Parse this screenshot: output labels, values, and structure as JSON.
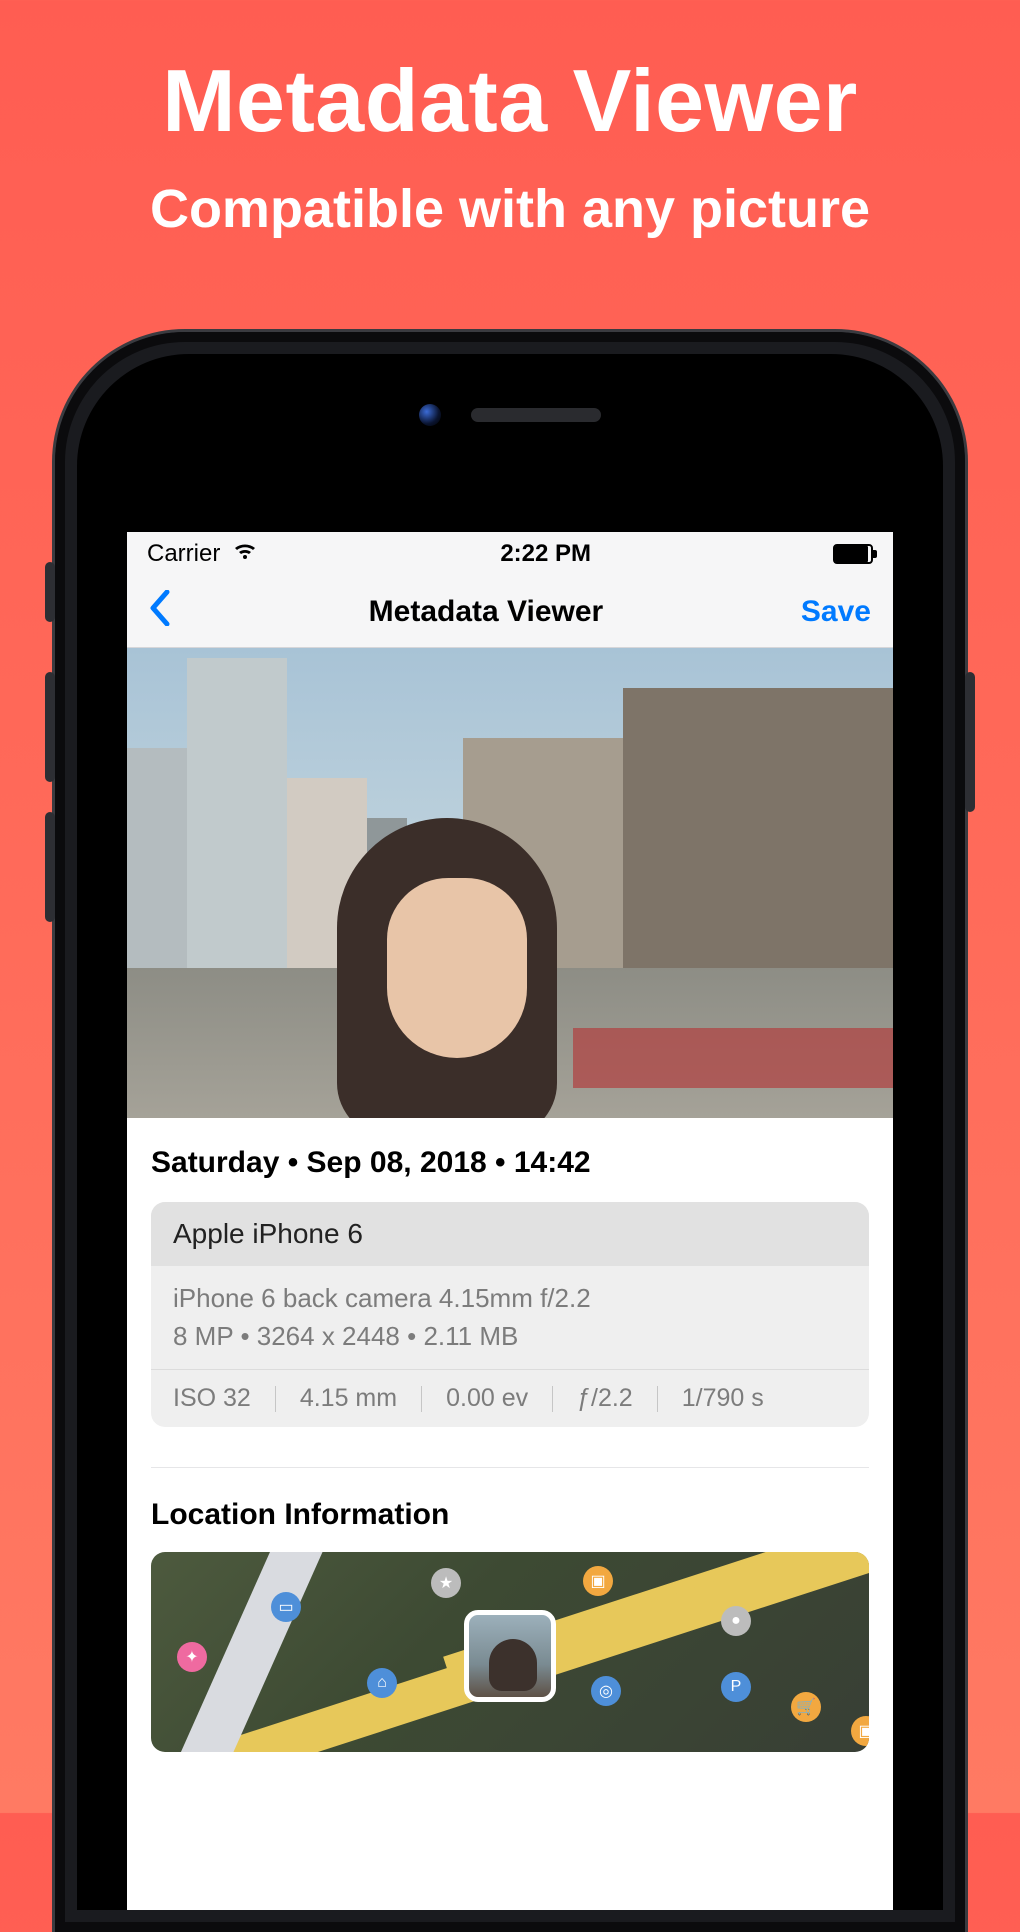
{
  "promo": {
    "title": "Metadata Viewer",
    "subtitle": "Compatible with any picture"
  },
  "statusbar": {
    "carrier": "Carrier",
    "time": "2:22 PM"
  },
  "nav": {
    "title": "Metadata Viewer",
    "save": "Save"
  },
  "datetime": "Saturday • Sep 08, 2018 • 14:42",
  "device_card": {
    "device": "Apple iPhone 6",
    "lens_line": "iPhone 6 back camera 4.15mm f/2.2",
    "resolution_line": "8 MP • 3264 x 2448 • 2.11 MB",
    "exif": {
      "iso": "ISO 32",
      "focal": "4.15 mm",
      "ev": "0.00 ev",
      "aperture": "ƒ/2.2",
      "shutter": "1/790 s"
    }
  },
  "location": {
    "title": "Location Information"
  }
}
